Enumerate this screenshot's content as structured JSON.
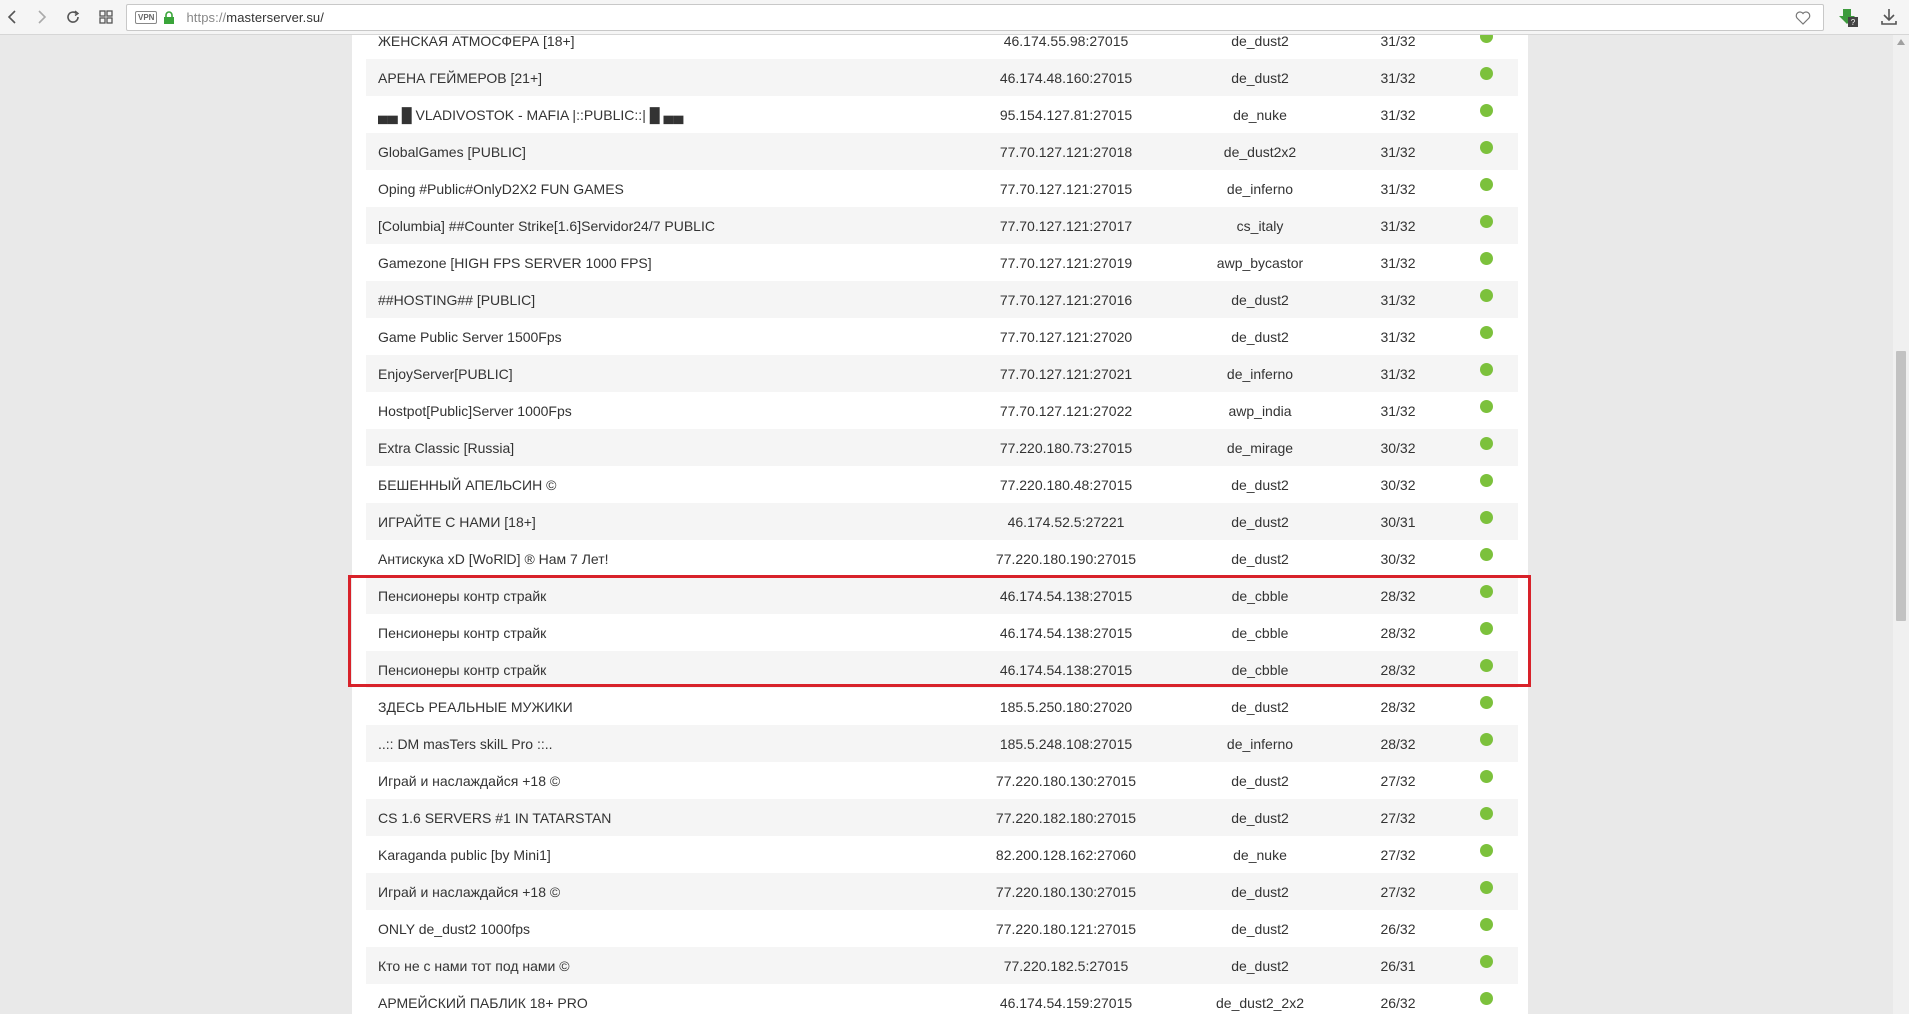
{
  "browser": {
    "url_scheme": "https://",
    "url_host": "masterserver.su/",
    "vpn_label": "VPN",
    "extension_badge": "?"
  },
  "servers": [
    {
      "name": "ЖЕНСКАЯ АТМОСФЕРА [18+]",
      "ip": "46.174.55.98:27015",
      "map": "de_dust2",
      "players": "31/32"
    },
    {
      "name": "АРЕНА ГЕЙМЕРОВ [21+]",
      "ip": "46.174.48.160:27015",
      "map": "de_dust2",
      "players": "31/32"
    },
    {
      "name": "▄▄ █ VLADIVOSTOK - MAFIA |::PUBLIC::| █ ▄▄",
      "ip": "95.154.127.81:27015",
      "map": "de_nuke",
      "players": "31/32"
    },
    {
      "name": "GlobalGames [PUBLIC]",
      "ip": "77.70.127.121:27018",
      "map": "de_dust2x2",
      "players": "31/32"
    },
    {
      "name": "Oping #Public#OnlyD2X2 FUN GAMES",
      "ip": "77.70.127.121:27015",
      "map": "de_inferno",
      "players": "31/32"
    },
    {
      "name": "[Columbia] ##Counter Strike[1.6]Servidor24/7 PUBLIC",
      "ip": "77.70.127.121:27017",
      "map": "cs_italy",
      "players": "31/32"
    },
    {
      "name": "Gamezone [HIGH FPS SERVER 1000 FPS]",
      "ip": "77.70.127.121:27019",
      "map": "awp_bycastor",
      "players": "31/32"
    },
    {
      "name": "##HOSTING## [PUBLIC]",
      "ip": "77.70.127.121:27016",
      "map": "de_dust2",
      "players": "31/32"
    },
    {
      "name": "Game Public Server 1500Fps",
      "ip": "77.70.127.121:27020",
      "map": "de_dust2",
      "players": "31/32"
    },
    {
      "name": "EnjoyServer[PUBLIC]",
      "ip": "77.70.127.121:27021",
      "map": "de_inferno",
      "players": "31/32"
    },
    {
      "name": "Hostpot[Public]Server 1000Fps",
      "ip": "77.70.127.121:27022",
      "map": "awp_india",
      "players": "31/32"
    },
    {
      "name": "Extra Classic [Russia]",
      "ip": "77.220.180.73:27015",
      "map": "de_mirage",
      "players": "30/32"
    },
    {
      "name": "БЕШЕННЫЙ АПЕЛЬСИН ©",
      "ip": "77.220.180.48:27015",
      "map": "de_dust2",
      "players": "30/32"
    },
    {
      "name": "ИГРАЙТЕ С НАМИ [18+]",
      "ip": "46.174.52.5:27221",
      "map": "de_dust2",
      "players": "30/31"
    },
    {
      "name": "Антискука xD [WoRlD] ® Нам 7 Лет!",
      "ip": "77.220.180.190:27015",
      "map": "de_dust2",
      "players": "30/32"
    },
    {
      "name": "Пенсионеры контр страйк",
      "ip": "46.174.54.138:27015",
      "map": "de_cbble",
      "players": "28/32"
    },
    {
      "name": "Пенсионеры контр страйк",
      "ip": "46.174.54.138:27015",
      "map": "de_cbble",
      "players": "28/32"
    },
    {
      "name": "Пенсионеры контр страйк",
      "ip": "46.174.54.138:27015",
      "map": "de_cbble",
      "players": "28/32"
    },
    {
      "name": "ЗДЕСЬ РЕАЛЬНЫЕ МУЖИКИ",
      "ip": "185.5.250.180:27020",
      "map": "de_dust2",
      "players": "28/32"
    },
    {
      "name": "..:: DM masTers skilL Pro ::..",
      "ip": "185.5.248.108:27015",
      "map": "de_inferno",
      "players": "28/32"
    },
    {
      "name": "Играй и наслаждайся +18 ©",
      "ip": "77.220.180.130:27015",
      "map": "de_dust2",
      "players": "27/32"
    },
    {
      "name": "CS 1.6 SERVERS #1 IN TATARSTAN",
      "ip": "77.220.182.180:27015",
      "map": "de_dust2",
      "players": "27/32"
    },
    {
      "name": "Karaganda public [by Mini1]",
      "ip": "82.200.128.162:27060",
      "map": "de_nuke",
      "players": "27/32"
    },
    {
      "name": "Играй и наслаждайся +18 ©",
      "ip": "77.220.180.130:27015",
      "map": "de_dust2",
      "players": "27/32"
    },
    {
      "name": "ONLY de_dust2 1000fps",
      "ip": "77.220.180.121:27015",
      "map": "de_dust2",
      "players": "26/32"
    },
    {
      "name": "Кто не с нами тот под нами ©",
      "ip": "77.220.182.5:27015",
      "map": "de_dust2",
      "players": "26/31"
    },
    {
      "name": "АРМЕЙСКИЙ ПАБЛИК 18+ PRO",
      "ip": "46.174.54.159:27015",
      "map": "de_dust2_2x2",
      "players": "26/32"
    }
  ],
  "status_color": "#7cc13c",
  "highlight_color": "#d8222a"
}
